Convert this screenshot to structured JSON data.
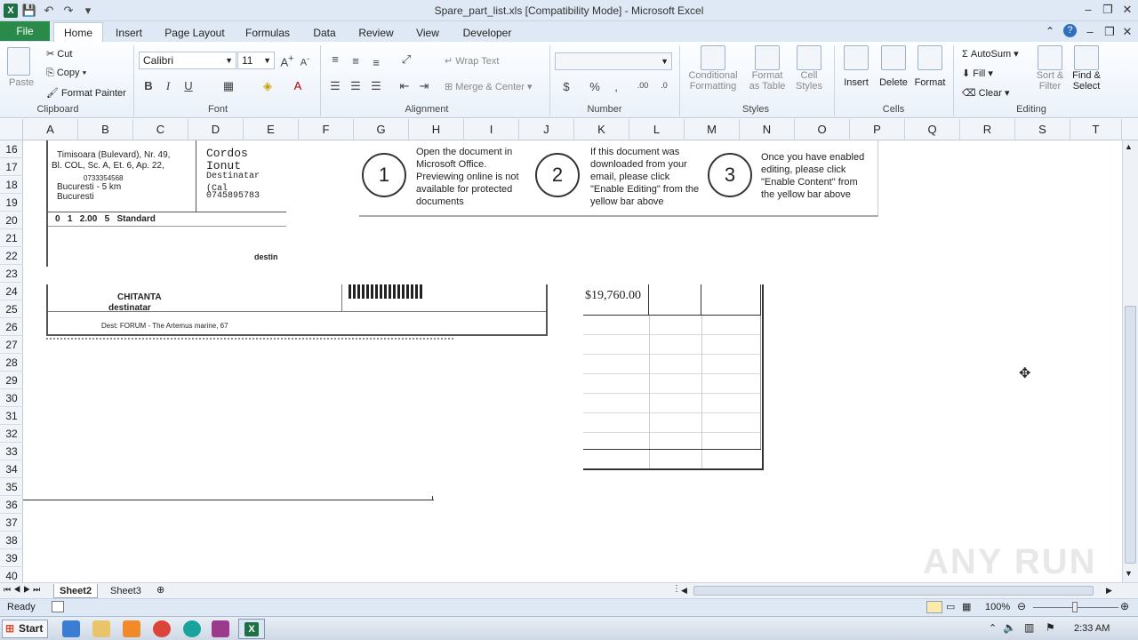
{
  "window": {
    "title": "Spare_part_list.xls  [Compatibility Mode] - Microsoft Excel",
    "app_icon": "X"
  },
  "tabs": [
    "File",
    "Home",
    "Insert",
    "Page Layout",
    "Formulas",
    "Data",
    "Review",
    "View",
    "Developer"
  ],
  "ribbon": {
    "clipboard": {
      "paste": "Paste",
      "cut": "Cut",
      "copy": "Copy",
      "format_painter": "Format Painter",
      "label": "Clipboard"
    },
    "font": {
      "name": "Calibri",
      "size": "11",
      "label": "Font"
    },
    "alignment": {
      "wrap": "Wrap Text",
      "merge": "Merge & Center",
      "label": "Alignment"
    },
    "number": {
      "label": "Number",
      "format": ""
    },
    "styles": {
      "cond1": "Conditional",
      "cond2": "Formatting",
      "table1": "Format",
      "table2": "as Table",
      "cell1": "Cell",
      "cell2": "Styles",
      "label": "Styles"
    },
    "cells": {
      "insert": "Insert",
      "delete": "Delete",
      "format": "Format",
      "label": "Cells"
    },
    "editing": {
      "autosum": "AutoSum",
      "fill": "Fill",
      "clear": "Clear",
      "sort1": "Sort &",
      "sort2": "Filter",
      "find1": "Find &",
      "find2": "Select",
      "label": "Editing"
    }
  },
  "columns": [
    "A",
    "B",
    "C",
    "D",
    "E",
    "F",
    "G",
    "H",
    "I",
    "J",
    "K",
    "L",
    "M",
    "N",
    "O",
    "P",
    "Q",
    "R",
    "S",
    "T"
  ],
  "rows": [
    "16",
    "17",
    "18",
    "19",
    "20",
    "21",
    "22",
    "23",
    "24",
    "25",
    "26",
    "27",
    "28",
    "29",
    "30",
    "31",
    "32",
    "33",
    "34",
    "35",
    "36",
    "37",
    "38",
    "39",
    "40"
  ],
  "overlay": {
    "step1": "Open the document in Microsoft Office. Previewing online is not available for protected documents",
    "step2": "If this document was downloaded from your email, please click \"Enable Editing\" from the yellow bar above",
    "step3": "Once you have enabled editing, please click \"Enable Content\" from the yellow bar above",
    "n1": "1",
    "n2": "2",
    "n3": "3"
  },
  "receipt": {
    "addr1": "Timisoara (Bulevard), Nr. 49,",
    "addr2": "Bl. COL, Sc. A, Et. 6, Ap. 22,",
    "addr3": "0733354568",
    "addr4": "Bucuresti - 5 km",
    "addr5": "Bucuresti",
    "recipient": "Cordos Ionut",
    "recipient2": "Destinatar (Cal",
    "phone": "0745895783",
    "row1": "0   1   2.00   5   Standard",
    "row2": "CHITANTA",
    "row3": "destinatar",
    "row4": "Dest: FORUM - The Artemus marine, 67",
    "dest": "destin"
  },
  "cell_value": "$19,760.00",
  "sheet_tabs": [
    "Sheet2",
    "Sheet3"
  ],
  "status": {
    "ready": "Ready",
    "zoom": "100%"
  },
  "taskbar": {
    "start": "Start",
    "clock": "2:33 AM"
  },
  "watermark": "ANY RUN"
}
